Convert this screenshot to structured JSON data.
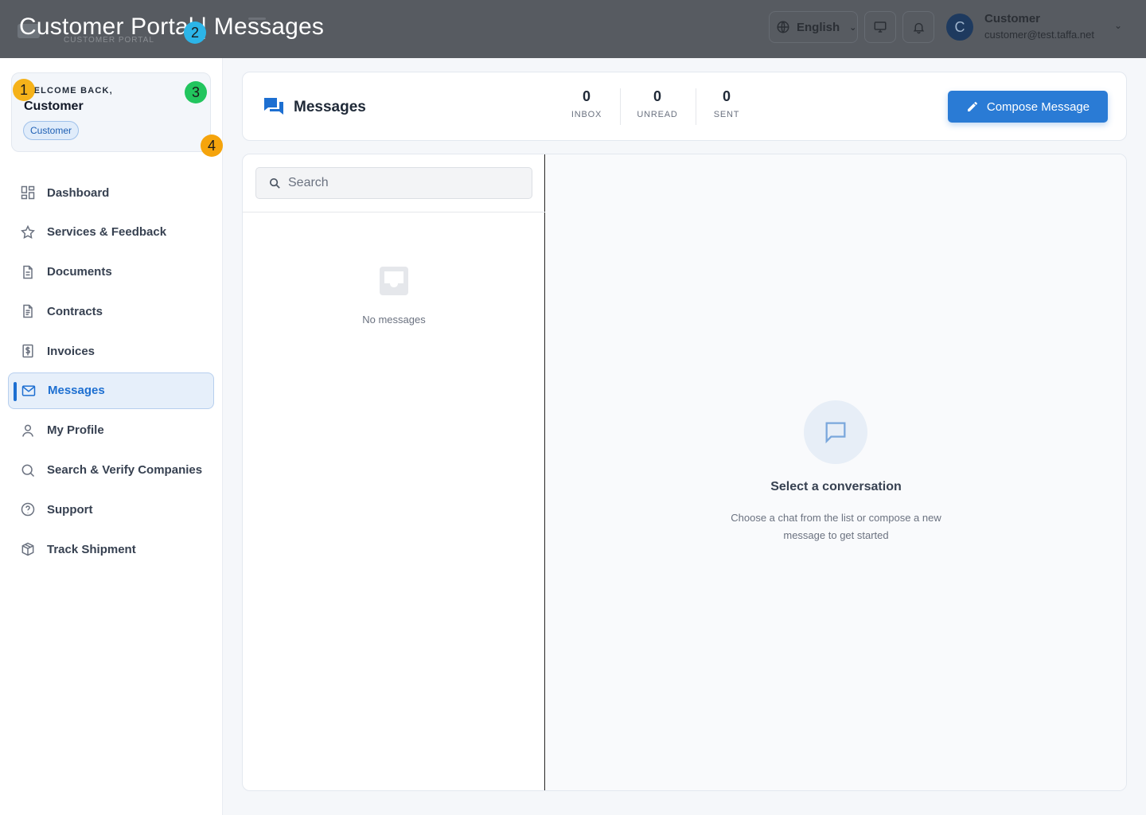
{
  "window": {
    "title": "Customer Portal | Messages"
  },
  "header": {
    "brand_subtitle": "CUSTOMER PORTAL",
    "language": {
      "label": "English"
    },
    "user": {
      "initial": "C",
      "name": "Customer",
      "email": "customer@test.taffa.net"
    },
    "icons": [
      "globe-icon",
      "monitor-icon",
      "bell-icon",
      "chevron-down-icon",
      "menu-icon"
    ]
  },
  "sidebar": {
    "welcome": {
      "label": "WELCOME BACK,",
      "name": "Customer",
      "role": "Customer"
    },
    "items": [
      {
        "label": "Dashboard",
        "icon": "grid-icon"
      },
      {
        "label": "Services & Feedback",
        "icon": "star-icon"
      },
      {
        "label": "Documents",
        "icon": "document-icon"
      },
      {
        "label": "Contracts",
        "icon": "contract-icon"
      },
      {
        "label": "Invoices",
        "icon": "invoice-icon"
      },
      {
        "label": "Messages",
        "icon": "mail-icon",
        "active": true
      },
      {
        "label": "My Profile",
        "icon": "user-icon"
      },
      {
        "label": "Search & Verify Companies",
        "icon": "search-icon"
      },
      {
        "label": "Support",
        "icon": "help-icon"
      },
      {
        "label": "Track Shipment",
        "icon": "package-icon"
      }
    ]
  },
  "messages": {
    "title": "Messages",
    "stats": [
      {
        "value": "0",
        "label": "INBOX"
      },
      {
        "value": "0",
        "label": "UNREAD"
      },
      {
        "value": "0",
        "label": "SENT"
      }
    ],
    "compose_label": "Compose Message",
    "search_placeholder": "Search",
    "empty_list_text": "No messages",
    "conversation": {
      "title": "Select a conversation",
      "subtitle": "Choose a chat from the list or compose a new message to get started"
    }
  },
  "markers": [
    "1",
    "2",
    "3",
    "4"
  ],
  "colors": {
    "accent": "#2a7bd5",
    "active_nav_bg": "#e6effa",
    "topbar": "#575b61",
    "marker_1": "#f5b21a",
    "marker_2": "#2cb5e8",
    "marker_3": "#22c55e",
    "marker_4": "#f5a40c"
  }
}
